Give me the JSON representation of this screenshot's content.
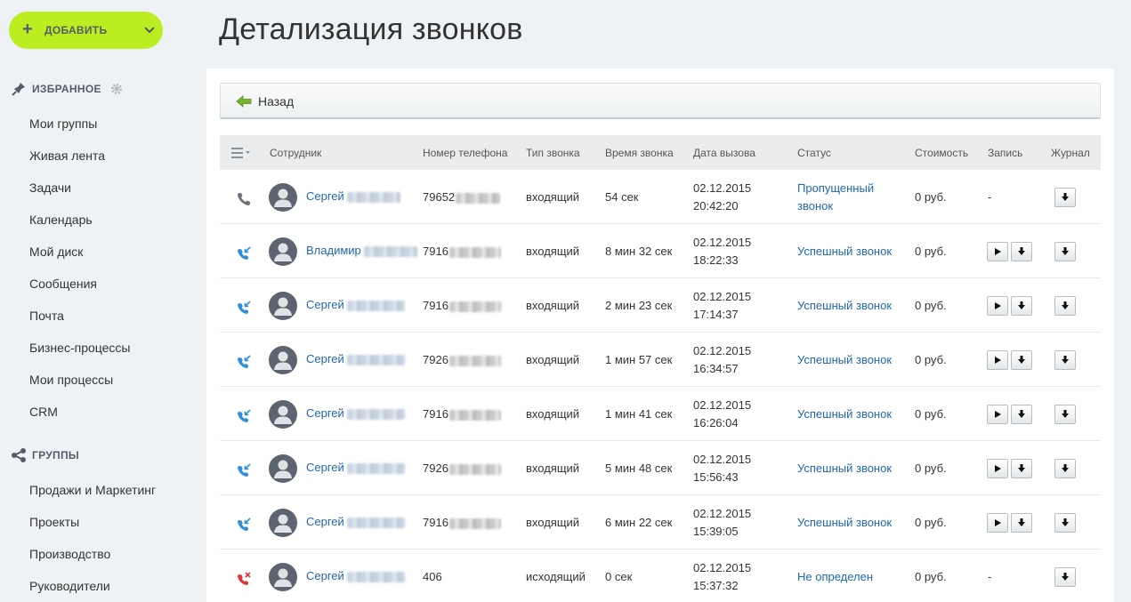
{
  "sidebar": {
    "add_button": "ДОБАВИТЬ",
    "favorites_title": "ИЗБРАННОЕ",
    "favorites_items": [
      "Мои группы",
      "Живая лента",
      "Задачи",
      "Календарь",
      "Мой диск",
      "Сообщения",
      "Почта",
      "Бизнес-процессы",
      "Мои процессы",
      "CRM"
    ],
    "groups_title": "ГРУППЫ",
    "groups_items": [
      "Продажи и Маркетинг",
      "Проекты",
      "Производство",
      "Руководители"
    ]
  },
  "page": {
    "title": "Детализация звонков",
    "back_label": "Назад"
  },
  "table": {
    "headers": {
      "employee": "Сотрудник",
      "phone": "Номер телефона",
      "call_type": "Тип звонка",
      "call_time": "Время звонка",
      "call_date": "Дата вызова",
      "status": "Статус",
      "cost": "Стоимость",
      "record": "Запись",
      "log": "Журнал"
    },
    "rows": [
      {
        "kind": "incoming-missed",
        "name": "Сергей",
        "phone": "79652",
        "type": "входящий",
        "duration": "54 сек",
        "date": "02.12.2015",
        "time": "20:42:20",
        "status_line1": "Пропущенный",
        "status_line2": "звонок",
        "cost": "0 руб.",
        "record": "-"
      },
      {
        "kind": "incoming",
        "name": "Владимир",
        "phone": "7916",
        "type": "входящий",
        "duration": "8 мин 32 сек",
        "date": "02.12.2015",
        "time": "18:22:33",
        "status_line1": "Успешный звонок",
        "status_line2": "",
        "cost": "0 руб.",
        "record": ""
      },
      {
        "kind": "incoming",
        "name": "Сергей",
        "phone": "7916",
        "type": "входящий",
        "duration": "2 мин 23 сек",
        "date": "02.12.2015",
        "time": "17:14:37",
        "status_line1": "Успешный звонок",
        "status_line2": "",
        "cost": "0 руб.",
        "record": ""
      },
      {
        "kind": "incoming",
        "name": "Сергей",
        "phone": "7926",
        "type": "входящий",
        "duration": "1 мин 57 сек",
        "date": "02.12.2015",
        "time": "16:34:57",
        "status_line1": "Успешный звонок",
        "status_line2": "",
        "cost": "0 руб.",
        "record": ""
      },
      {
        "kind": "incoming",
        "name": "Сергей",
        "phone": "7916",
        "type": "входящий",
        "duration": "1 мин 41 сек",
        "date": "02.12.2015",
        "time": "16:26:04",
        "status_line1": "Успешный звонок",
        "status_line2": "",
        "cost": "0 руб.",
        "record": ""
      },
      {
        "kind": "incoming",
        "name": "Сергей",
        "phone": "7926",
        "type": "входящий",
        "duration": "5 мин 48 сек",
        "date": "02.12.2015",
        "time": "15:56:43",
        "status_line1": "Успешный звонок",
        "status_line2": "",
        "cost": "0 руб.",
        "record": ""
      },
      {
        "kind": "incoming",
        "name": "Сергей",
        "phone": "7916",
        "type": "входящий",
        "duration": "6 мин 22 сек",
        "date": "02.12.2015",
        "time": "15:39:05",
        "status_line1": "Успешный звонок",
        "status_line2": "",
        "cost": "0 руб.",
        "record": ""
      },
      {
        "kind": "outgoing-failed",
        "name": "Сергей",
        "phone": "406",
        "type": "исходящий",
        "duration": "0 сек",
        "date": "02.12.2015",
        "time": "15:37:32",
        "status_line1": "Не определен",
        "status_line2": "",
        "cost": "0 руб.",
        "record": "-"
      }
    ]
  },
  "colors": {
    "accent_green": "#bbed21",
    "link_blue": "#2067b0",
    "incoming_icon": "#2f8fd8",
    "failed_icon": "#e0333a"
  }
}
